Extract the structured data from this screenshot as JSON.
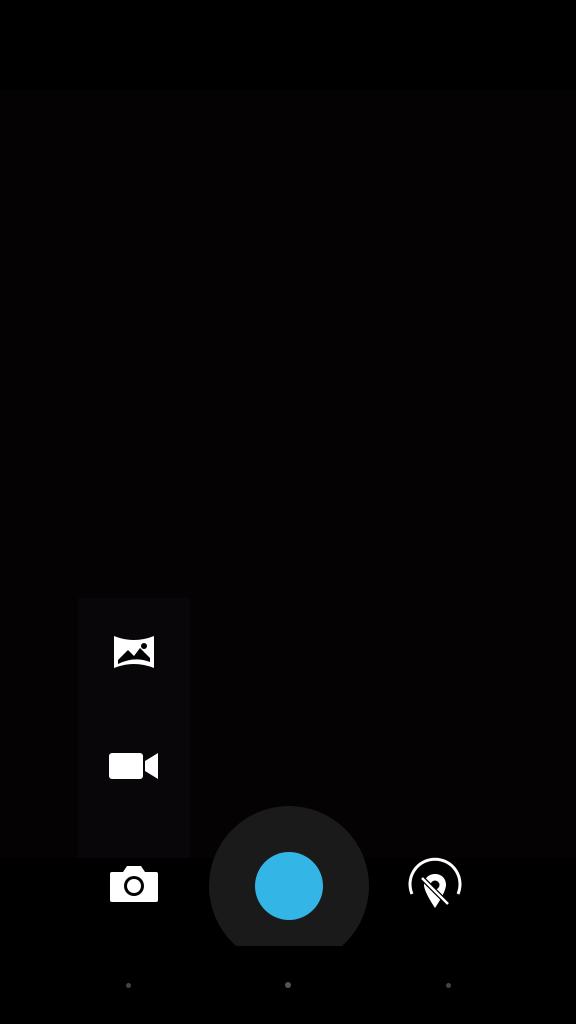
{
  "app": {
    "name": "Camera"
  },
  "modes": [
    {
      "name": "panorama",
      "icon": "panorama-icon"
    },
    {
      "name": "video",
      "icon": "video-camera-icon"
    },
    {
      "name": "photo",
      "icon": "camera-icon"
    }
  ],
  "controls": {
    "shutter_icon": "shutter-icon",
    "settings_icon": "settings-icon"
  },
  "colors": {
    "accent": "#33b5e5",
    "viewfinder_bg": "#050204",
    "mode_panel_bg": "#080608",
    "shutter_ring": "#1a1a1a",
    "icon": "#ffffff"
  },
  "nav": {
    "dots": [
      "back",
      "home",
      "recents"
    ]
  }
}
